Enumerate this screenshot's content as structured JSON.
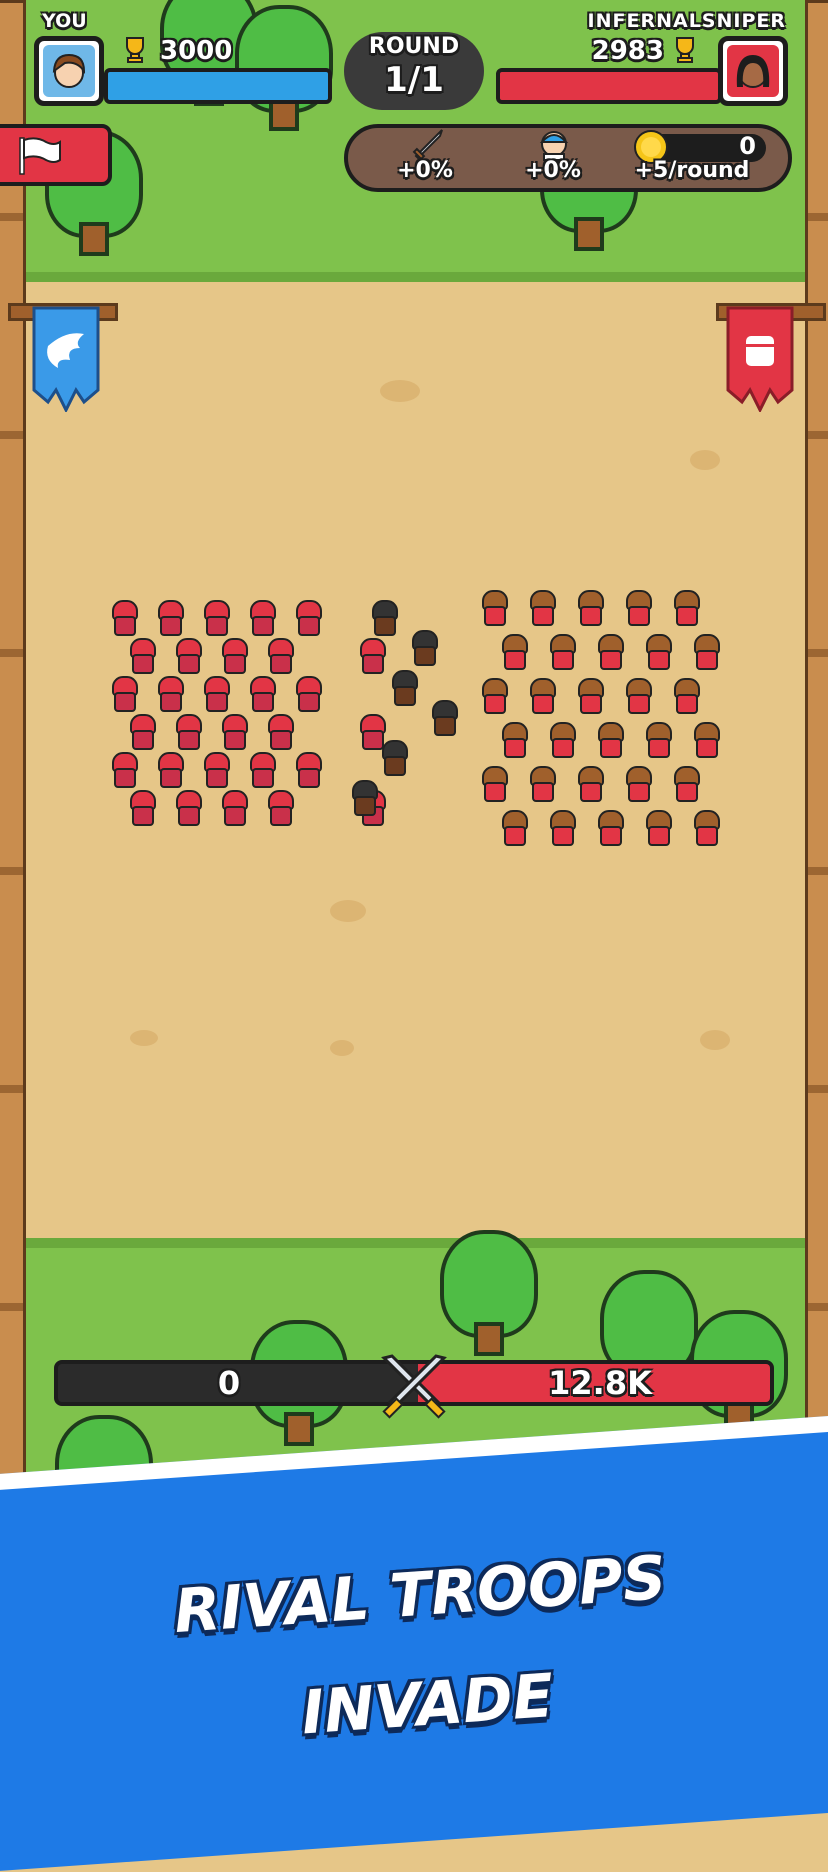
{
  "player": {
    "label": "YOU",
    "trophies": "3000",
    "bar_color": "#2fa0e6"
  },
  "opponent": {
    "label": "INFERNALSNIPER",
    "trophies": "2983",
    "bar_color": "#e23545"
  },
  "round": {
    "label": "ROUND",
    "value": "1/1"
  },
  "bonuses": {
    "attack": {
      "icon": "sword-icon",
      "value": "+0%"
    },
    "troops": {
      "icon": "soldier-icon",
      "value": "+0%"
    },
    "gold": {
      "icon": "coin-icon",
      "count": "0",
      "value": "+5/round"
    }
  },
  "surrender_button": {
    "icon": "white-flag-icon"
  },
  "banners": {
    "player": "wing-banner-icon",
    "opponent": "fist-banner-icon"
  },
  "power_bar": {
    "player_value": "0",
    "opponent_value": "12.8K",
    "icon": "crossed-swords-icon"
  },
  "promo": {
    "text": "RIVAL TROOPS INVADE"
  },
  "colors": {
    "grass": "#7fc24c",
    "sand": "#e6c688",
    "player_blue": "#2fa0e6",
    "enemy_red": "#e23545",
    "promo_blue": "#1e7ae6"
  }
}
